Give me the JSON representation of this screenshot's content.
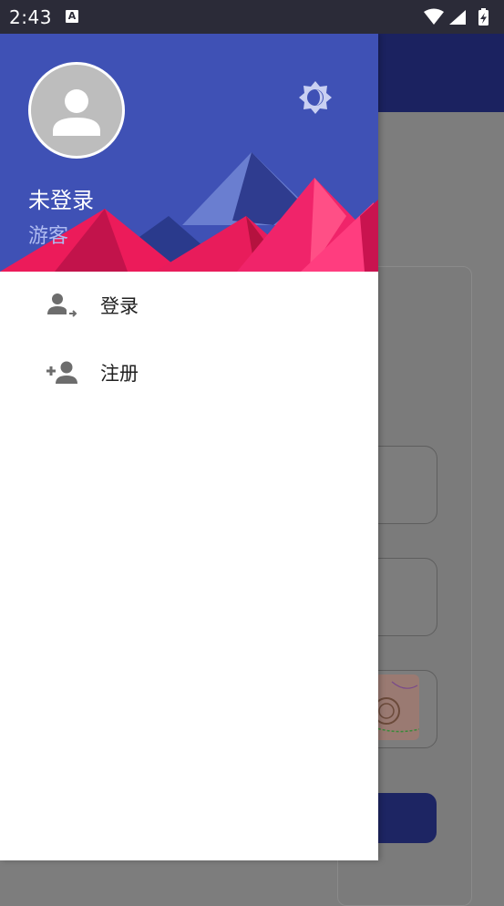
{
  "status_bar": {
    "time": "2:43",
    "notification_icon": "A",
    "icons": [
      "wifi-icon",
      "signal-icon",
      "battery-charging-icon"
    ]
  },
  "drawer": {
    "header": {
      "avatar_icon": "person-icon",
      "theme_toggle_icon": "brightness-icon",
      "user_name": "未登录",
      "user_role": "游客",
      "colors": {
        "background": "#3f51b5",
        "accent_pink": "#e91e63",
        "accent_navy": "#283593"
      }
    },
    "menu": [
      {
        "icon": "login-icon",
        "label": "登录"
      },
      {
        "icon": "person-add-icon",
        "label": "注册"
      }
    ]
  },
  "background_app": {
    "toolbar_color": "#1a237e",
    "button_color": "#1a237e"
  }
}
